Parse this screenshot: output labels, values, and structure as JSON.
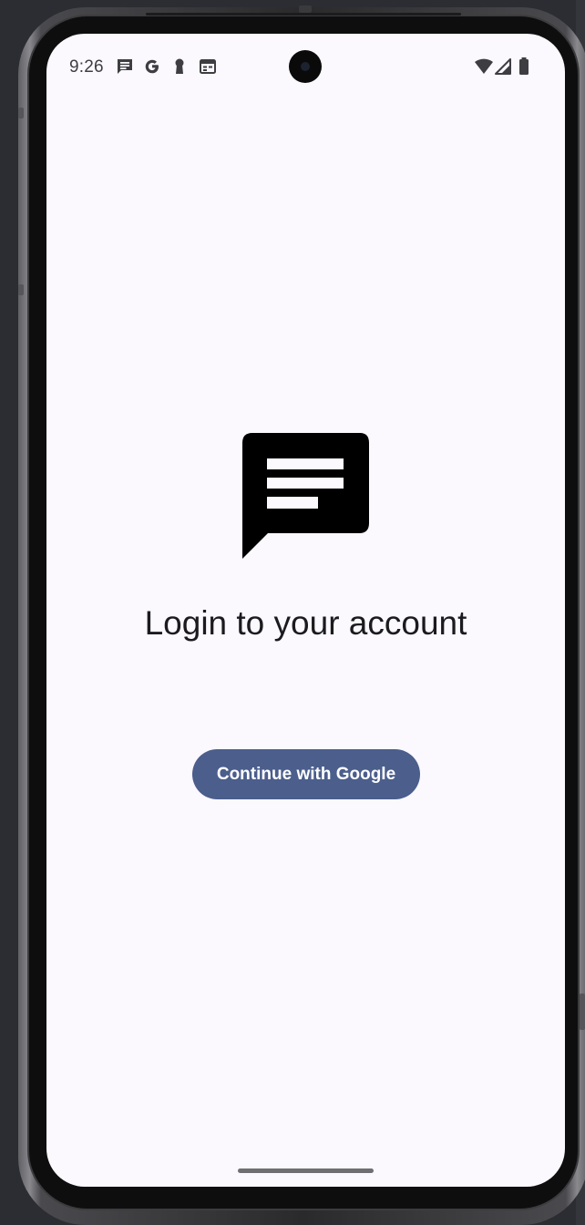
{
  "status_bar": {
    "time": "9:26",
    "left_icons": [
      "message-icon",
      "google-g-icon",
      "keyhole-icon",
      "calendar-icon"
    ],
    "right_icons": [
      "wifi-icon",
      "cell-signal-icon",
      "battery-icon"
    ]
  },
  "login": {
    "logo_icon": "chat-bubble-icon",
    "title": "Login to your account",
    "google_button_label": "Continue with Google"
  },
  "colors": {
    "screen_background": "#fbf8fe",
    "primary_button": "#4b5e8c",
    "title_text": "#1b1b1f"
  }
}
